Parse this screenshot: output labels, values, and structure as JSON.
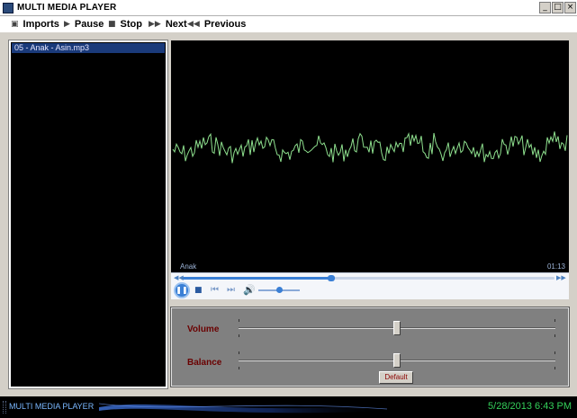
{
  "window": {
    "title": "MULTI MEDIA PLAYER",
    "controls": {
      "minimize": "_",
      "maximize": "□",
      "close": "×"
    }
  },
  "menu": {
    "items": [
      {
        "label": "Imports",
        "icon": "folder-icon"
      },
      {
        "label": "Pause",
        "icon": "pause-icon"
      },
      {
        "label": "Stop",
        "icon": "stop-icon"
      },
      {
        "label": "Next",
        "icon": "next-icon"
      },
      {
        "label": "Previous",
        "icon": "previous-icon"
      }
    ]
  },
  "playlist": {
    "items": [
      "05 - Anak - Asin.mp3"
    ]
  },
  "player": {
    "track_title": "Anak",
    "time": "01:13",
    "seek_fraction": 0.4,
    "mini_volume_fraction": 0.5,
    "wave_color": "#8ee08e",
    "accent_color": "#3a7fd5"
  },
  "adjust": {
    "volume_label": "Volume",
    "balance_label": "Balance",
    "volume_fraction": 0.5,
    "balance_fraction": 0.5,
    "default_label": "Default"
  },
  "status": {
    "title": "MULTI MEDIA PLAYER",
    "datetime": "5/28/2013  6:43 PM"
  }
}
